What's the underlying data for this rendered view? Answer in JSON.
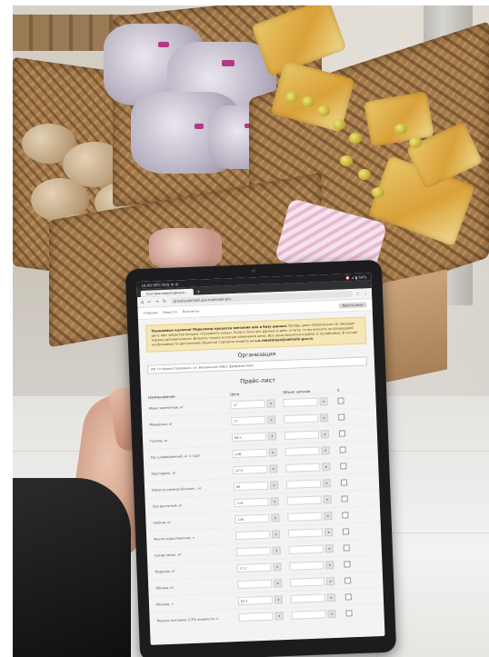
{
  "photo": {
    "subject": "hand holding tablet in grocery store produce section"
  },
  "statusbar": {
    "left": "16:40 МТС RUS ✉ ⚙ ·",
    "right": "⏰ ⊿ ▮ 54%"
  },
  "browser": {
    "tab_label": "Система мониторинга...",
    "tab_add": "+",
    "url": "grocery.sakhalin.gov.ru/private-pric"
  },
  "site_nav": {
    "item_1": "Главная",
    "item_2": "Новости",
    "item_3": "Контакты",
    "action_label": "Ввести цены"
  },
  "notice": {
    "lead": "Уважаемые коллеги! Пересмотр процесса внесения цен в базу данных",
    "body": "Теперь цены обязательно на текущую дату при закрытии окошка «Сохранить цены». Если в поле нет данных в день отчета, то вы вносите за прошедший период автоматически. Внесите только в случае изменения цены. Все цены вносятся в рубли (с копейками). В случае необходимости дополнения объектов торговли пишите на",
    "email": "s.a.rebelskaya@sakhalin.gov.ru"
  },
  "organization": {
    "title": "Организация",
    "selected": "ИП Т.Н.Ирина Сахалинск, ул. Вокзальная 49Б/1 (Дзержинский)"
  },
  "price_list": {
    "title": "Прайс-лист",
    "col_name": "Наименование",
    "col_price": "Цена",
    "col_volume": "Объем запасов",
    "col_check": "5",
    "rows": [
      {
        "name": "Мука пшеничная, кг",
        "price": "37"
      },
      {
        "name": "Макароны, кг",
        "price": "77"
      },
      {
        "name": "Гречка, кг",
        "price": "66.5"
      },
      {
        "name": "Рис шлифованный, кг 1 сорт",
        "price": "148"
      },
      {
        "name": "Картофель, кг",
        "price": "47.9"
      },
      {
        "name": "Капуста свежая белокоч., кг",
        "price": "68"
      },
      {
        "name": "Лук репчатый, кг",
        "price": "119"
      },
      {
        "name": "Свёкла, кг",
        "price": "136"
      },
      {
        "name": "Масло подсолнечное, л",
        "price": ""
      },
      {
        "name": "Сахар-песок, кг",
        "price": ""
      },
      {
        "name": "Морковь, кг",
        "price": "77.2"
      },
      {
        "name": "Яблоки, кг",
        "price": ""
      },
      {
        "name": "Молоко, л",
        "price": "82.5"
      },
      {
        "name": "Молоко питьевое 3.2% жирности, л",
        "price": ""
      }
    ]
  }
}
